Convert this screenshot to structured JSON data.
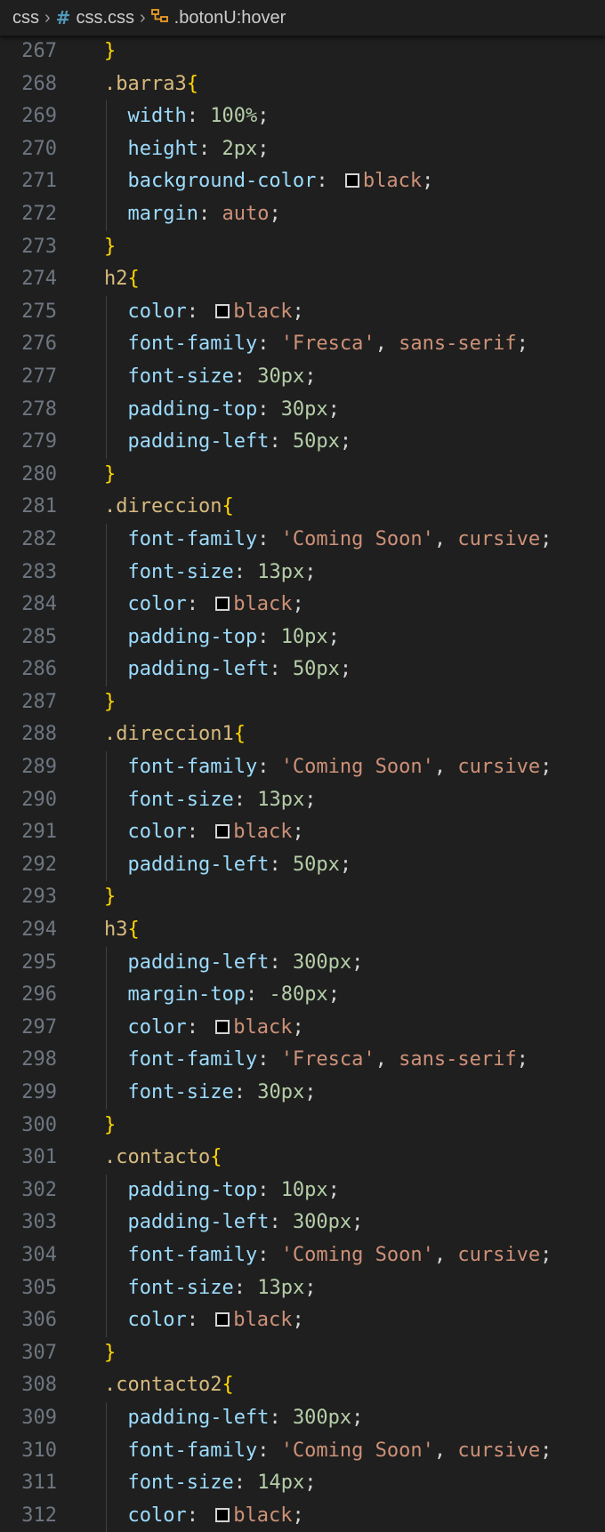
{
  "breadcrumb": {
    "folder": "css",
    "file": "css.css",
    "symbol": ".botonU:hover"
  },
  "swatch_color": "#000000",
  "lines": [
    {
      "n": "267",
      "code": "}"
    },
    {
      "n": "268",
      "code": ".barra3{"
    },
    {
      "n": "269",
      "code": "  width: 100%;"
    },
    {
      "n": "270",
      "code": "  height: 2px;"
    },
    {
      "n": "271",
      "code": "  background-color: ▢black;"
    },
    {
      "n": "272",
      "code": "  margin: auto;"
    },
    {
      "n": "273",
      "code": "}"
    },
    {
      "n": "274",
      "code": "h2{"
    },
    {
      "n": "275",
      "code": "  color: ▢black;"
    },
    {
      "n": "276",
      "code": "  font-family: 'Fresca', sans-serif;"
    },
    {
      "n": "277",
      "code": "  font-size: 30px;"
    },
    {
      "n": "278",
      "code": "  padding-top: 30px;"
    },
    {
      "n": "279",
      "code": "  padding-left: 50px;"
    },
    {
      "n": "280",
      "code": "}"
    },
    {
      "n": "281",
      "code": ".direccion{"
    },
    {
      "n": "282",
      "code": "  font-family: 'Coming Soon', cursive;"
    },
    {
      "n": "283",
      "code": "  font-size: 13px;"
    },
    {
      "n": "284",
      "code": "  color: ▢black;"
    },
    {
      "n": "285",
      "code": "  padding-top: 10px;"
    },
    {
      "n": "286",
      "code": "  padding-left: 50px;"
    },
    {
      "n": "287",
      "code": "}"
    },
    {
      "n": "288",
      "code": ".direccion1{"
    },
    {
      "n": "289",
      "code": "  font-family: 'Coming Soon', cursive;"
    },
    {
      "n": "290",
      "code": "  font-size: 13px;"
    },
    {
      "n": "291",
      "code": "  color: ▢black;"
    },
    {
      "n": "292",
      "code": "  padding-left: 50px;"
    },
    {
      "n": "293",
      "code": "}"
    },
    {
      "n": "294",
      "code": "h3{"
    },
    {
      "n": "295",
      "code": "  padding-left: 300px;"
    },
    {
      "n": "296",
      "code": "  margin-top: -80px;"
    },
    {
      "n": "297",
      "code": "  color: ▢black;"
    },
    {
      "n": "298",
      "code": "  font-family: 'Fresca', sans-serif;"
    },
    {
      "n": "299",
      "code": "  font-size: 30px;"
    },
    {
      "n": "300",
      "code": "}"
    },
    {
      "n": "301",
      "code": ".contacto{"
    },
    {
      "n": "302",
      "code": "  padding-top: 10px;"
    },
    {
      "n": "303",
      "code": "  padding-left: 300px;"
    },
    {
      "n": "304",
      "code": "  font-family: 'Coming Soon', cursive;"
    },
    {
      "n": "305",
      "code": "  font-size: 13px;"
    },
    {
      "n": "306",
      "code": "  color: ▢black;"
    },
    {
      "n": "307",
      "code": "}"
    },
    {
      "n": "308",
      "code": ".contacto2{"
    },
    {
      "n": "309",
      "code": "  padding-left: 300px;"
    },
    {
      "n": "310",
      "code": "  font-family: 'Coming Soon', cursive;"
    },
    {
      "n": "311",
      "code": "  font-size: 14px;"
    },
    {
      "n": "312",
      "code": "  color: ▢black;"
    }
  ]
}
